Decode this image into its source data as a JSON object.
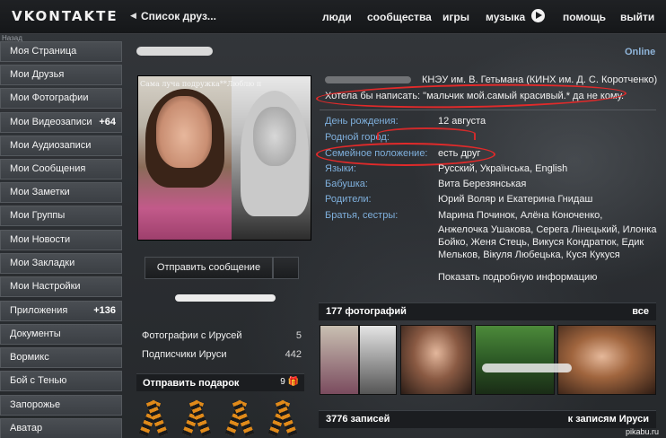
{
  "topbar": {
    "logo": "VKONTAKTE",
    "breadcrumb": "Список друз...",
    "nav": [
      "люди",
      "сообщества",
      "игры",
      "музыка",
      "помощь",
      "выйти"
    ],
    "back_label": "Назад"
  },
  "sidebar": {
    "items": [
      {
        "label": "Моя Страница",
        "count": ""
      },
      {
        "label": "Мои Друзья",
        "count": ""
      },
      {
        "label": "Мои Фотографии",
        "count": ""
      },
      {
        "label": "Мои Видеозаписи",
        "count": "+64"
      },
      {
        "label": "Мои Аудиозаписи",
        "count": ""
      },
      {
        "label": "Мои Сообщения",
        "count": ""
      },
      {
        "label": "Мои Заметки",
        "count": ""
      },
      {
        "label": "Мои Группы",
        "count": ""
      },
      {
        "label": "Мои Новости",
        "count": ""
      },
      {
        "label": "Мои Закладки",
        "count": ""
      },
      {
        "label": "Мои Настройки",
        "count": ""
      },
      {
        "label": "Приложения",
        "count": "+136"
      },
      {
        "label": "Документы",
        "count": ""
      },
      {
        "label": "Вормикс",
        "count": ""
      },
      {
        "label": "Бой с Тенью",
        "count": ""
      },
      {
        "label": "Запорожье",
        "count": ""
      },
      {
        "label": "Аватар",
        "count": ""
      }
    ]
  },
  "profile": {
    "status": "Online",
    "photo_caption": "Сама луча подружка**Люблю п",
    "send_message": "Отправить сообщение",
    "university": "КНЭУ им. В. Гетьмана (КИНХ им. Д. С. Коротченко)",
    "status_text": "Хотела бы написать: \"мальчик мой.самый красивый.* да не кому.",
    "fields": [
      {
        "label": "День рождения:",
        "value": "12 августа"
      },
      {
        "label": "Родной город:",
        "value": ""
      },
      {
        "label": "Семейное положение:",
        "value": "есть друг"
      },
      {
        "label": "Языки:",
        "value": "Русский, Українська, English"
      },
      {
        "label": "Бабушка:",
        "value": "Вита Березянськая"
      },
      {
        "label": "Родители:",
        "value": "Юрий Воляр и Екатерина Гнидаш"
      },
      {
        "label": "Братья, сестры:",
        "value": "Марина Починок, Алёна Коноченко,"
      }
    ],
    "siblings_more": [
      "Анжелочка Ушакова, Серега Лінецький, Илонка",
      "Бойко, Женя Стець, Викуся Кондратюк, Едик",
      "Мельков, Вікуля Любецька, Куся Кукуся"
    ],
    "show_more": "Показать подробную информацию"
  },
  "left_lists": [
    {
      "label": "Фотографии с Ирусей",
      "count": "5"
    },
    {
      "label": "Подписчики Ируси",
      "count": "442"
    }
  ],
  "gifts": {
    "title": "Отправить подарок",
    "count": "9"
  },
  "photos_section": {
    "title": "177 фотографий",
    "link": "все"
  },
  "wall_section": {
    "title": "3776 записей",
    "link": "к записям Ируси"
  },
  "watermark": "pikabu.ru",
  "colors": {
    "accent_link": "#7fb0dd",
    "highlight": "#e12a2a",
    "online": "#8fb4d9"
  }
}
